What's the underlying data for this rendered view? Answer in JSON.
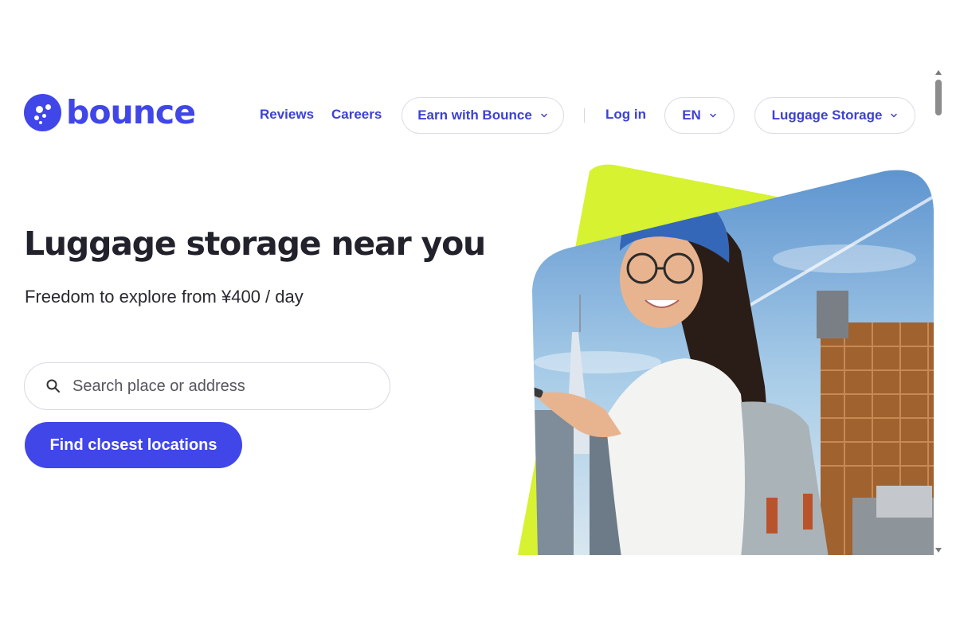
{
  "brand": {
    "name": "bounce",
    "color": "#4046e8",
    "accent": "#d6f230"
  },
  "nav": {
    "reviews": "Reviews",
    "careers": "Careers",
    "earn": "Earn with Bounce",
    "login": "Log in",
    "language": "EN",
    "luggage": "Luggage Storage"
  },
  "hero": {
    "title": "Luggage storage near you",
    "subtitle": "Freedom to explore from ¥400 / day",
    "search_placeholder": "Search place or address",
    "cta": "Find closest locations"
  },
  "icons": {
    "search": "search-icon",
    "chevron": "chevron-down-icon"
  }
}
